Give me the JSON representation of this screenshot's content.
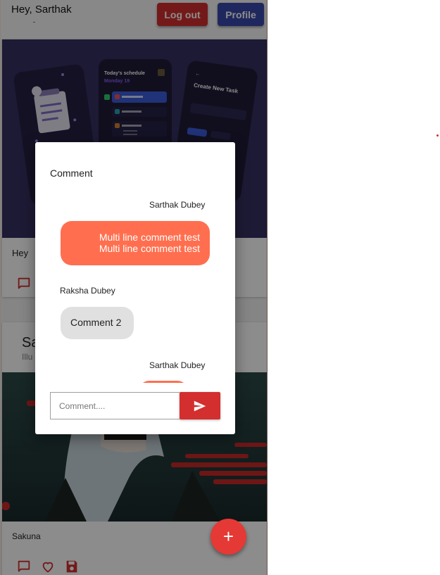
{
  "header": {
    "greeting": "Hey, Sarthak",
    "logout_label": "Log out",
    "profile_label": "Profile"
  },
  "feed": {
    "posts": [
      {
        "caption": "Hey",
        "image_text": {
          "schedule_title": "Today's schedule",
          "schedule_date": "Monday 19",
          "task_title": "Create New Task"
        }
      },
      {
        "title": "Sa",
        "subtitle": "Illu",
        "caption": "Sakuna"
      }
    ]
  },
  "dialog": {
    "title": "Comment",
    "comments": [
      {
        "author": "Sarthak Dubey",
        "text_line1": "Multi line comment test",
        "text_line2": "Multi line comment test",
        "mine": true
      },
      {
        "author": "Raksha Dubey",
        "text": "Comment 2",
        "mine": false
      },
      {
        "author": "Sarthak Dubey",
        "mine": true
      }
    ],
    "input_placeholder": "Comment...."
  },
  "fab": {
    "label": "+"
  },
  "colors": {
    "primary_red": "#d32f2f",
    "profile_blue": "#3949ab",
    "my_bubble": "#ff6f4f",
    "other_bubble": "#e0e0e0"
  }
}
